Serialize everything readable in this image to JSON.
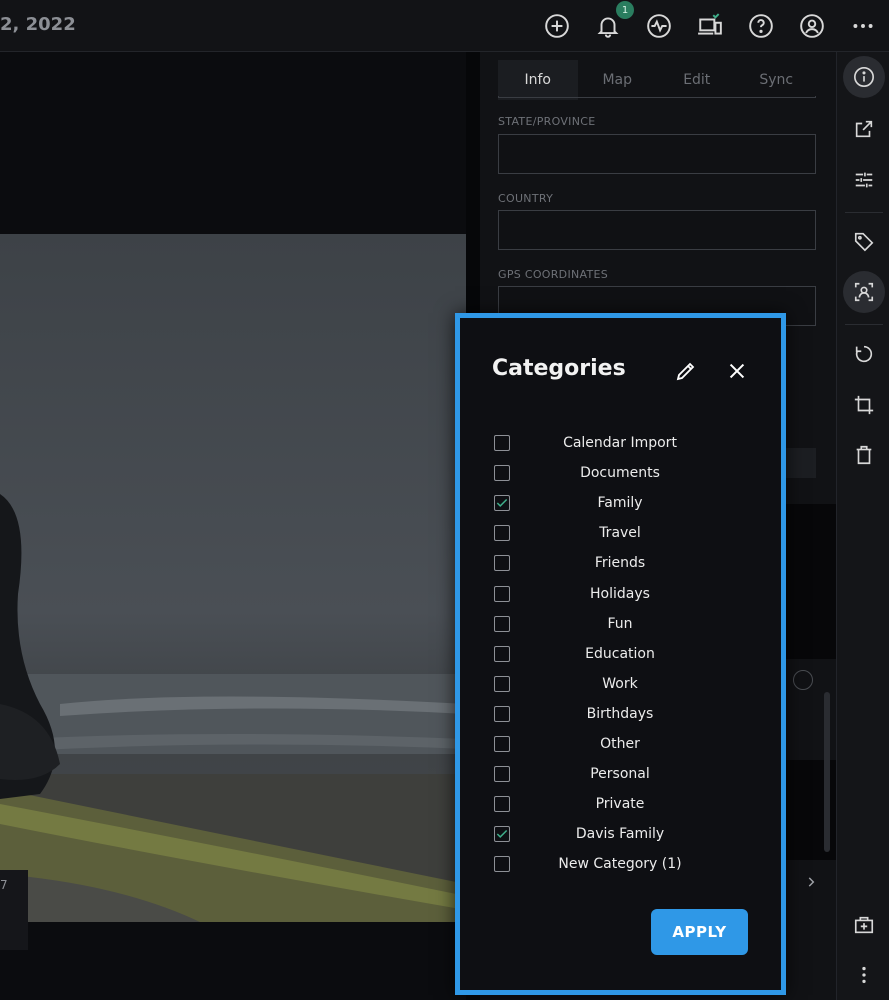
{
  "topbar": {
    "date": "2, 2022",
    "notification_count": "1",
    "icons": [
      "add-circle-icon",
      "bell-icon",
      "activity-icon",
      "devices-icon",
      "help-icon",
      "account-icon",
      "more-horizontal-icon"
    ]
  },
  "info_panel": {
    "tabs": [
      {
        "label": "Info"
      },
      {
        "label": "Map"
      },
      {
        "label": "Edit"
      },
      {
        "label": "Sync"
      }
    ],
    "fields": {
      "state_label": "STATE/PROVINCE",
      "country_label": "COUNTRY",
      "gps_label": "GPS COORDINATES",
      "state_value": "",
      "country_value": "",
      "gps_value": ""
    }
  },
  "photo_footer": {
    "text": "7"
  },
  "rightbar": {
    "icons": [
      "info-icon",
      "open-external-icon",
      "adjust-icon",
      "tag-icon",
      "face-recognition-icon",
      "rotate-icon",
      "crop-icon",
      "trash-icon",
      "add-to-album-icon",
      "more-vertical-icon"
    ]
  },
  "categories_modal": {
    "title": "Categories",
    "apply_label": "APPLY",
    "items": [
      {
        "label": "Calendar Import",
        "checked": false
      },
      {
        "label": "Documents",
        "checked": false
      },
      {
        "label": "Family",
        "checked": true
      },
      {
        "label": "Travel",
        "checked": false
      },
      {
        "label": "Friends",
        "checked": false
      },
      {
        "label": "Holidays",
        "checked": false
      },
      {
        "label": "Fun",
        "checked": false
      },
      {
        "label": "Education",
        "checked": false
      },
      {
        "label": "Work",
        "checked": false
      },
      {
        "label": "Birthdays",
        "checked": false
      },
      {
        "label": "Other",
        "checked": false
      },
      {
        "label": "Personal",
        "checked": false
      },
      {
        "label": "Private",
        "checked": false
      },
      {
        "label": "Davis Family",
        "checked": true
      },
      {
        "label": "New Category (1)",
        "checked": false
      }
    ]
  },
  "colors": {
    "accent": "#2f98e7",
    "check": "#3fae8a",
    "badge": "#2a7d5f"
  }
}
